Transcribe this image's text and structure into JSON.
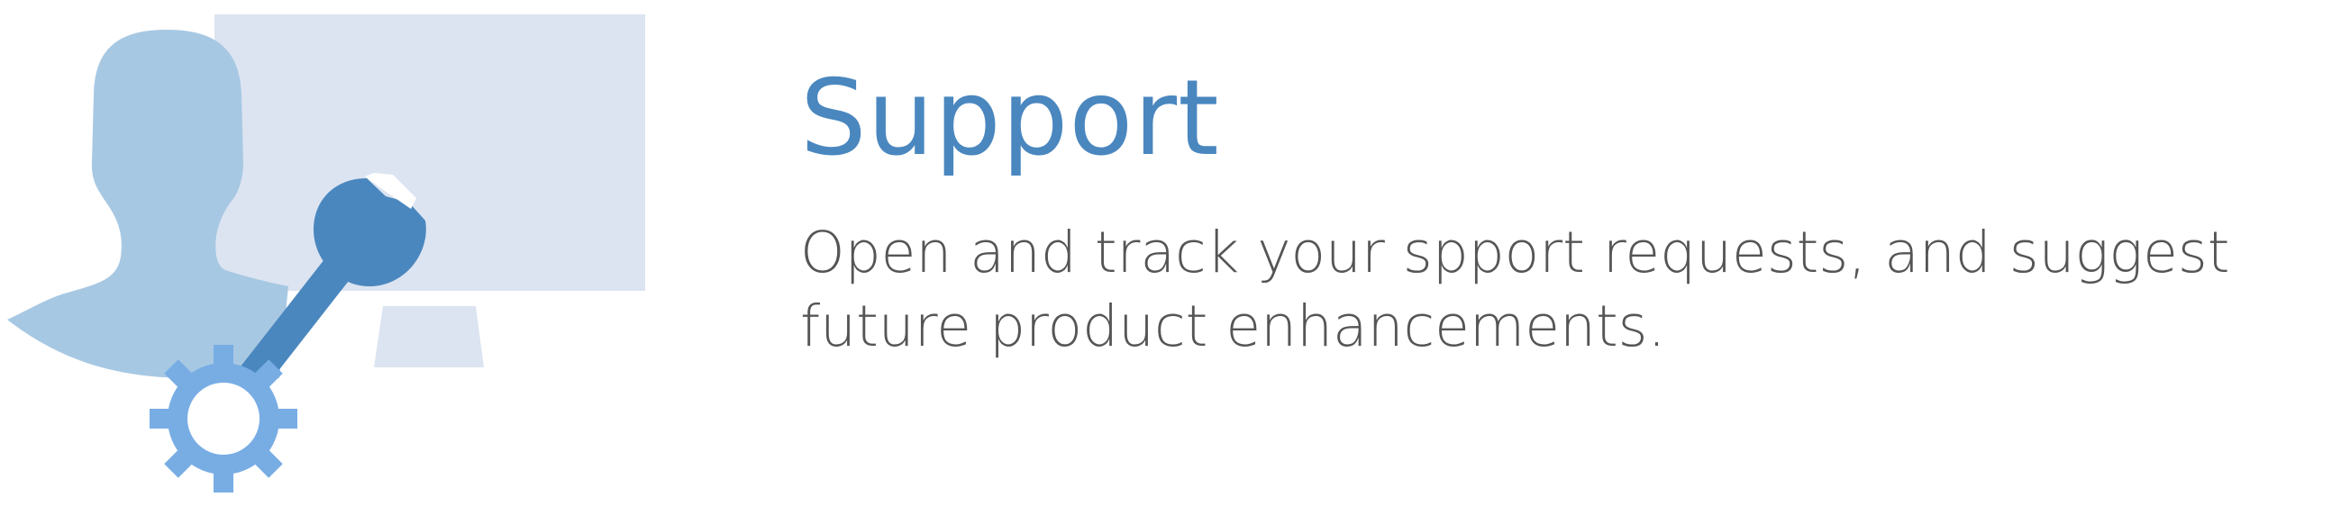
{
  "support_card": {
    "title": "Support",
    "description": "Open and track your spport requests, and suggest future product enhancements.",
    "colors": {
      "title": "#4a87bf",
      "description": "#555555",
      "monitor_screen": "#dce4f1",
      "person_silhouette": "#a7c8e3",
      "wrench": "#4a87bf",
      "gear": "#78ade4"
    },
    "icons": {
      "illustration": "support-illustration",
      "monitor": "monitor-icon",
      "person": "person-silhouette-icon",
      "wrench": "wrench-icon",
      "gear": "gear-icon"
    }
  }
}
